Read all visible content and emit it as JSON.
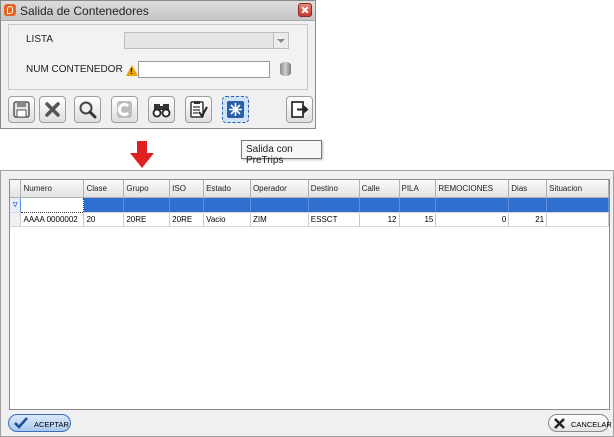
{
  "window": {
    "title": "Salida de Contenedores"
  },
  "form": {
    "lista_label": "LISTA",
    "lista_value": "",
    "num_label": "NUM CONTENEDOR",
    "num_value": ""
  },
  "toolbar": {
    "buttons": [
      "save-icon",
      "cancel-icon",
      "search-icon",
      "clear-icon",
      "binoculars-icon",
      "checklist-icon",
      "snowflake-icon",
      "exit-icon"
    ],
    "active": "snowflake-icon"
  },
  "tooltip": {
    "text": "Salida con PreTrips"
  },
  "grid": {
    "columns": [
      "Numero",
      "Clase",
      "Grupo",
      "ISO",
      "Estado",
      "Operador",
      "Destino",
      "Calle",
      "PILA",
      "REMOCIONES",
      "Dias",
      "Situacion"
    ],
    "filter_indicator": "∇",
    "rows": [
      [
        "AAAA 0000002",
        "20",
        "20RE",
        "20RE",
        "Vacio",
        "ZIM",
        "ESSCT",
        "12",
        "15",
        "0",
        "21",
        ""
      ]
    ]
  },
  "buttons": {
    "accept": "ACEPTAR",
    "cancel": "CANCELAR"
  },
  "colors": {
    "selection": "#2f6fd0",
    "arrow": "#e02020",
    "accent": "#3c6fb8"
  }
}
